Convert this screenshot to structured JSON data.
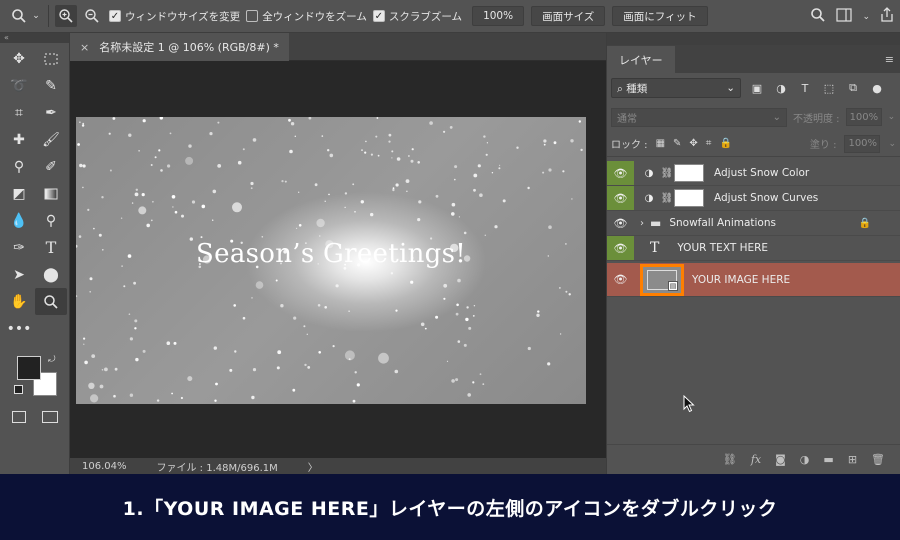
{
  "options_bar": {
    "tool_icon": "zoom-tool-icon",
    "zoom_in_icon": "zoom-in-icon",
    "zoom_out_icon": "zoom-out-icon",
    "resize_windows": {
      "label": "ウィンドウサイズを変更",
      "checked": true
    },
    "zoom_all": {
      "label": "全ウィンドウをズーム",
      "checked": false
    },
    "scrubby_zoom": {
      "label": "スクラブズーム",
      "checked": true
    },
    "zoom_value": "100%",
    "actual_pixels_button": "画面サイズ",
    "fit_screen_button": "画面にフィット"
  },
  "document": {
    "tab_title": "名称未設定 1 @ 106% (RGB/8#) *",
    "canvas_text": "Season’s Greetings!",
    "zoom_status": "106.04%",
    "file_status": "ファイル : 1.48M/696.1M",
    "status_chevron": "〉"
  },
  "layers_panel": {
    "tab_label": "レイヤー",
    "filter_kind": "種類",
    "blend_mode": "通常",
    "opacity_label": "不透明度 :",
    "opacity_value": "100%",
    "lock_label": "ロック :",
    "fill_label": "塗り :",
    "fill_value": "100%",
    "layers": [
      {
        "name": "Adjust Snow Color",
        "visible": true,
        "type": "adjustment"
      },
      {
        "name": "Adjust Snow Curves",
        "visible": true,
        "type": "adjustment"
      },
      {
        "name": "Snowfall Animations",
        "visible": true,
        "type": "group",
        "locked": true
      },
      {
        "name": "YOUR TEXT HERE",
        "visible": true,
        "type": "text"
      },
      {
        "name": "YOUR IMAGE HERE",
        "visible": true,
        "type": "smart-object",
        "highlighted": true
      }
    ]
  },
  "caption": {
    "text": "1.「YOUR IMAGE HERE」レイヤーの左側のアイコンをダブルクリック"
  },
  "colors": {
    "highlight_layer": "#a35a4d",
    "visible_eye_bg": "#6b8f3a",
    "thumb_outline": "#ff7f00",
    "caption_bg": "#0b1136"
  }
}
